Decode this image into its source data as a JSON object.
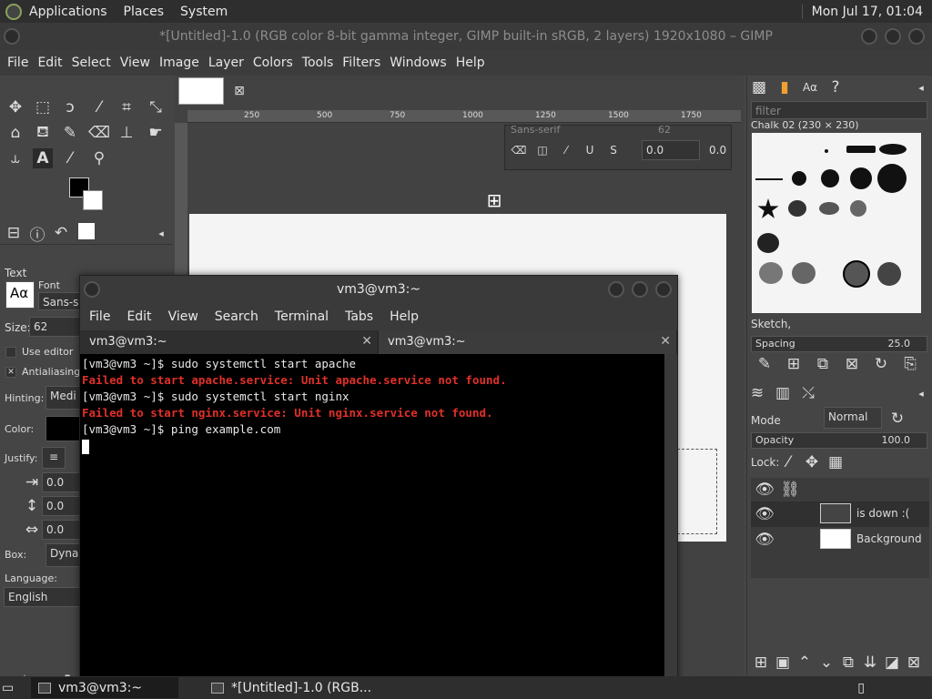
{
  "top_panel": {
    "menus": [
      "Applications",
      "Places",
      "System"
    ],
    "clock": "Mon Jul 17, 01:04"
  },
  "gimp": {
    "title": "*[Untitled]-1.0 (RGB color 8-bit gamma integer, GIMP built-in sRGB, 2 layers) 1920x1080 – GIMP",
    "menus": [
      "File",
      "Edit",
      "Select",
      "View",
      "Image",
      "Layer",
      "Colors",
      "Tools",
      "Filters",
      "Windows",
      "Help"
    ],
    "tool_options": {
      "section": "Text",
      "font_label": "Font",
      "font_value": "Sans-se",
      "size_label": "Size:",
      "size_value": "62",
      "use_editor": "Use editor",
      "antialiasing": "Antialiasing",
      "hinting_label": "Hinting:",
      "hinting_value": "Medi",
      "color_label": "Color:",
      "justify_label": "Justify:",
      "indent_values": [
        "0.0",
        "0.0",
        "0.0"
      ],
      "box_label": "Box:",
      "box_value": "Dynar",
      "language_label": "Language:",
      "language_value": "English"
    },
    "ruler_ticks": [
      "250",
      "500",
      "750",
      "1000",
      "1250",
      "1500",
      "1750"
    ],
    "text_toolbox": {
      "font_hint": "Sans-serif",
      "size_hint": "62",
      "value_a": "0.0",
      "value_b": "0.0"
    },
    "brushes": {
      "filter_placeholder": "filter",
      "current_brush": "Chalk 02 (230 × 230)",
      "tag": "Sketch,",
      "spacing_label": "Spacing",
      "spacing_value": "25.0"
    },
    "layers": {
      "mode_label": "Mode",
      "mode_value": "Normal",
      "opacity_label": "Opacity",
      "opacity_value": "100.0",
      "lock_label": "Lock:",
      "items": [
        {
          "name": "is down :("
        },
        {
          "name": "Background"
        }
      ]
    }
  },
  "terminal": {
    "title": "vm3@vm3:~",
    "menus": [
      "File",
      "Edit",
      "View",
      "Search",
      "Terminal",
      "Tabs",
      "Help"
    ],
    "tabs": [
      "vm3@vm3:~",
      "vm3@vm3:~"
    ],
    "lines": [
      {
        "text": "[vm3@vm3 ~]$ sudo systemctl start apache",
        "kind": "ok"
      },
      {
        "text": "Failed to start apache.service: Unit apache.service not found.",
        "kind": "err"
      },
      {
        "text": "[vm3@vm3 ~]$ sudo systemctl start nginx",
        "kind": "ok"
      },
      {
        "text": "Failed to start nginx.service: Unit nginx.service not found.",
        "kind": "err"
      },
      {
        "text": "[vm3@vm3 ~]$ ping example.com",
        "kind": "ok"
      }
    ]
  },
  "taskbar": {
    "items": [
      "vm3@vm3:~",
      "*[Untitled]-1.0 (RGB..."
    ]
  }
}
